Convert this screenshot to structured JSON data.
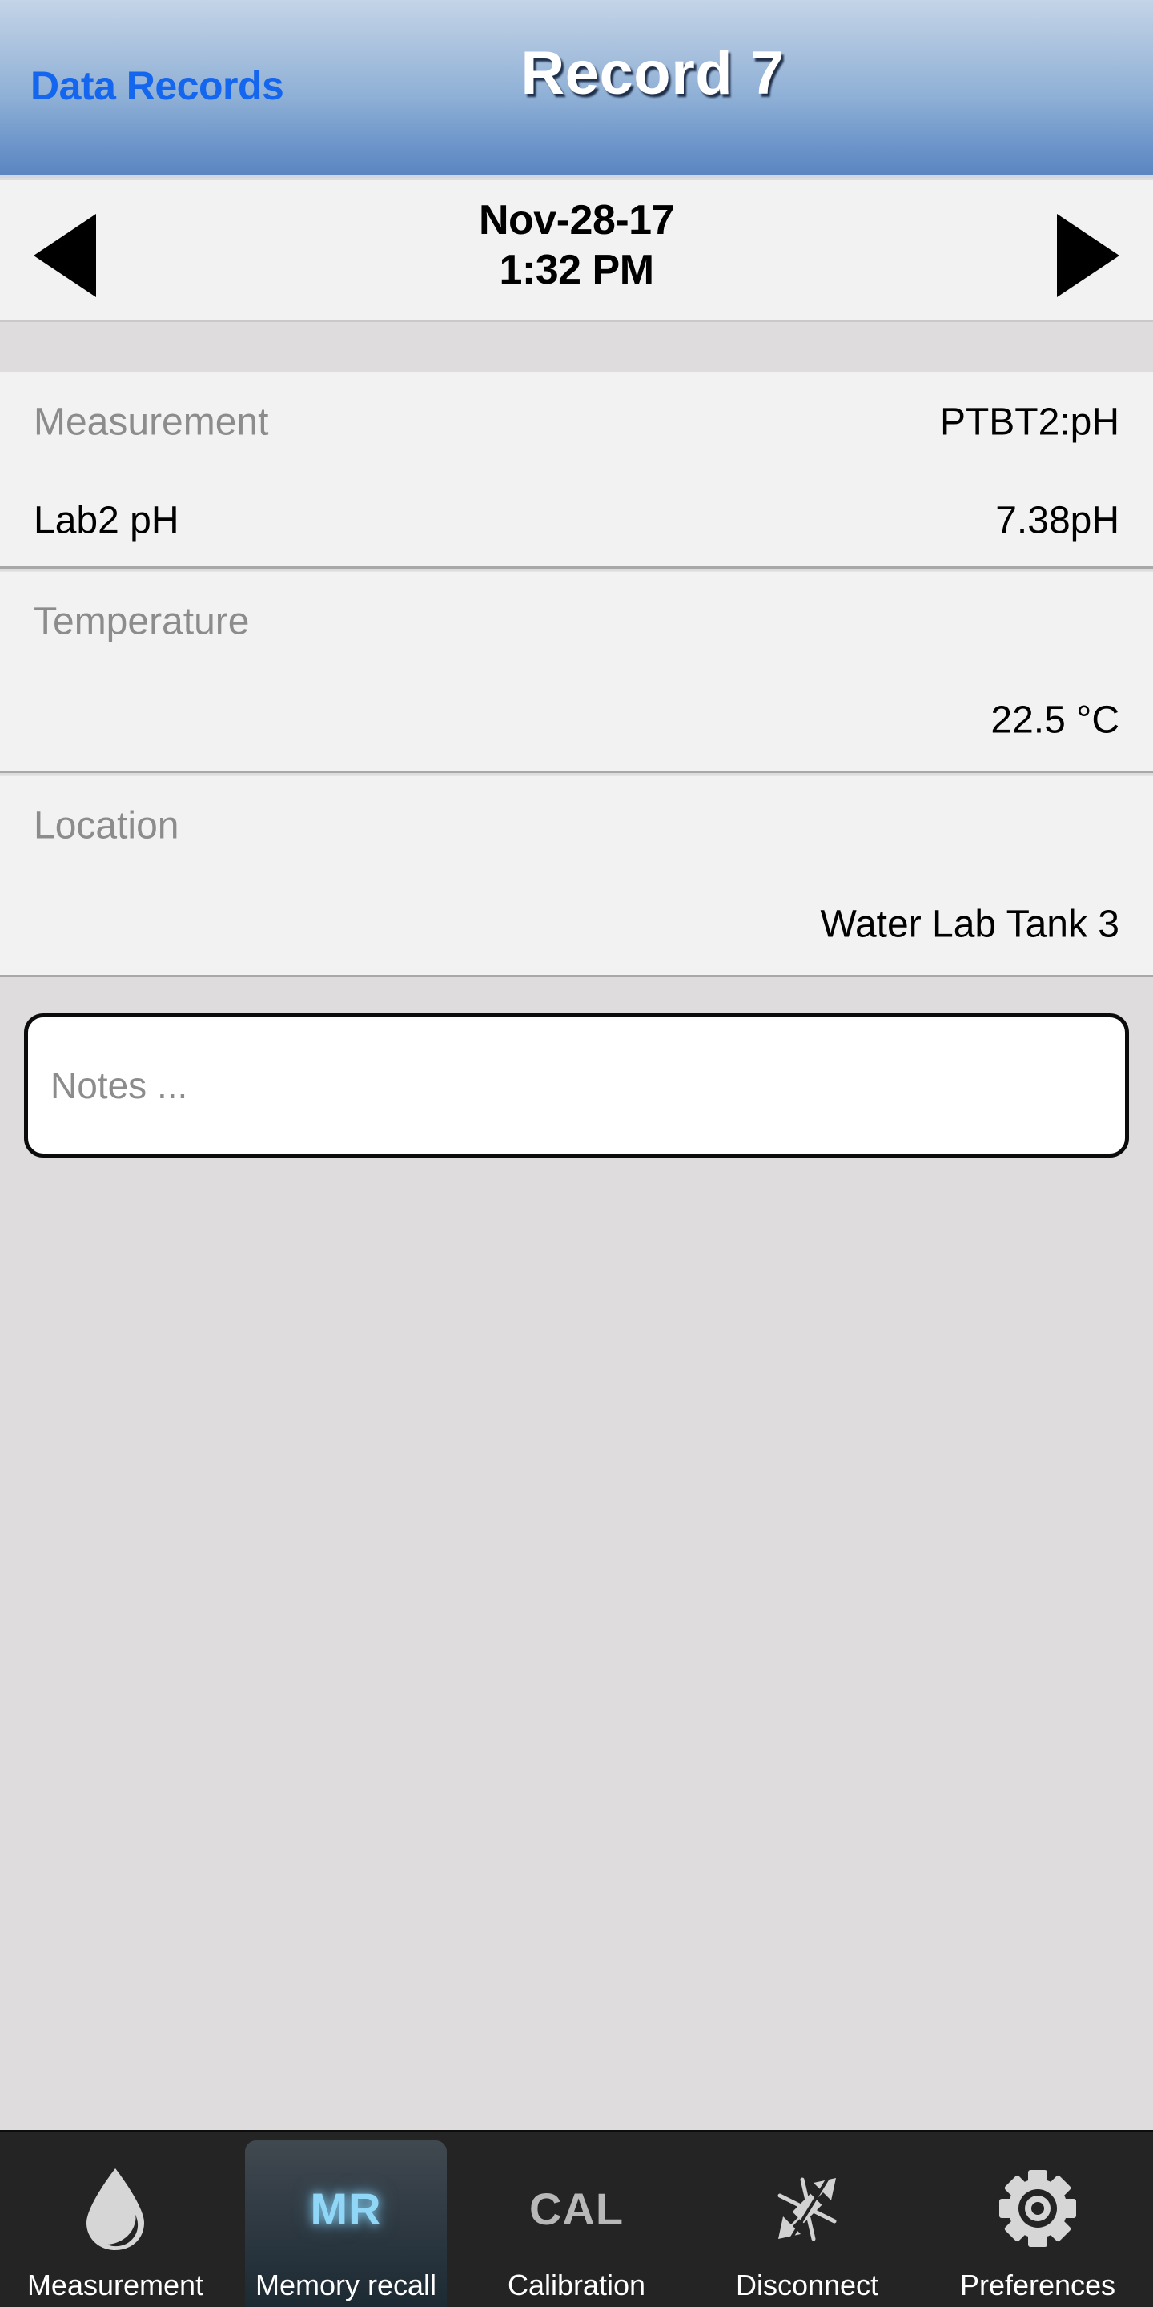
{
  "navbar": {
    "back_label": "Data Records",
    "title": "Record 7"
  },
  "stepper": {
    "prev_icon": "triangle-left-icon",
    "next_icon": "triangle-right-icon",
    "date": "Nov-28-17",
    "time": "1:32 PM"
  },
  "sections": [
    {
      "id": "measurement",
      "rows": [
        {
          "label": "Measurement",
          "value": "PTBT2:pH",
          "label_style": "muted"
        },
        {
          "label": "Lab2 pH",
          "value": "7.38pH",
          "label_style": "dark"
        }
      ]
    },
    {
      "id": "temperature",
      "rows": [
        {
          "label": "Temperature",
          "value": "",
          "label_style": "muted"
        },
        {
          "label": "",
          "value": "22.5 °C",
          "label_style": "dark"
        }
      ]
    },
    {
      "id": "location",
      "rows": [
        {
          "label": "Location",
          "value": "",
          "label_style": "muted"
        },
        {
          "label": "",
          "value": "Water Lab Tank 3",
          "label_style": "dark"
        }
      ]
    }
  ],
  "notes": {
    "placeholder": "Notes ...",
    "value": ""
  },
  "tabbar": {
    "active_index": 1,
    "tabs": [
      {
        "label": "Measurement",
        "icon": "water-droplet-icon",
        "icon_text": ""
      },
      {
        "label": "Memory recall",
        "icon": "mr-text-icon",
        "icon_text": "MR"
      },
      {
        "label": "Calibration",
        "icon": "cal-text-icon",
        "icon_text": "CAL"
      },
      {
        "label": "Disconnect",
        "icon": "bluetooth-disconnect-icon",
        "icon_text": ""
      },
      {
        "label": "Preferences",
        "icon": "gear-icon",
        "icon_text": ""
      }
    ]
  },
  "colors": {
    "accent_blue": "#1466ef",
    "header_gradient_top": "#c3d4e8",
    "header_gradient_bottom": "#5b85c0",
    "page_background": "#dedcdd",
    "section_background": "#f2f2f2",
    "muted_label": "#8c8c8c",
    "tabbar_background": "#242424",
    "active_tab_text": "#8fd6f7"
  }
}
